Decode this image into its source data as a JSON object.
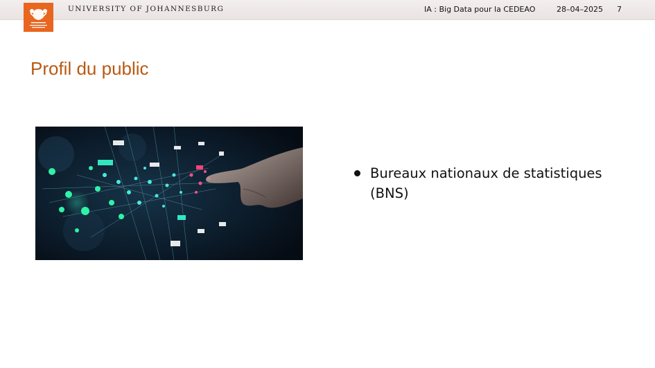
{
  "header": {
    "university": "UNIVERSITY OF JOHANNESBURG",
    "presentation_title": "IA : Big Data pour la CEDEAO",
    "date": "28–04–2025",
    "page_number": "7"
  },
  "slide": {
    "title": "Profil du public",
    "bullets": [
      "Bureaux nationaux de statistiques (BNS)"
    ]
  },
  "colors": {
    "accent_orange": "#e8661f",
    "title_brown": "#b85a12"
  },
  "icons": [
    "university-crest-icon"
  ]
}
